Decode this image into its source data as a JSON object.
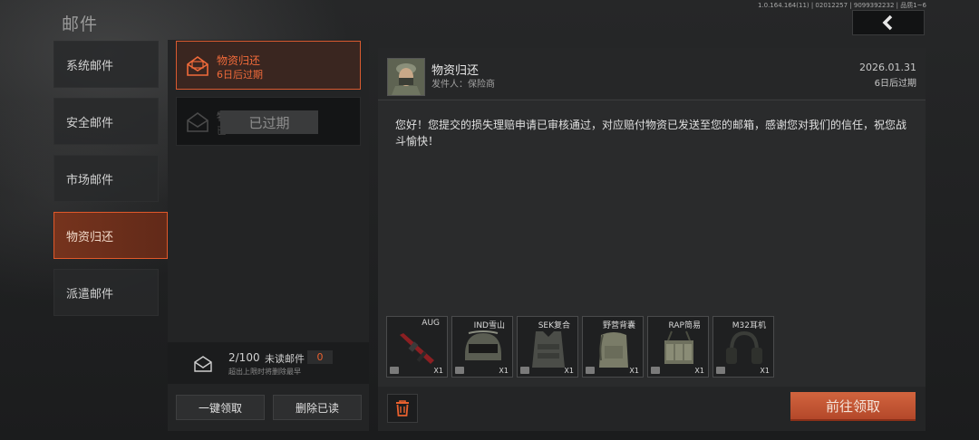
{
  "header": {
    "title": "邮件",
    "version": "1.0.164.164(11) | 02012257 | 9099392232 | 品质1~6",
    "back_icon": "chevron-left-icon"
  },
  "categories": [
    {
      "label": "系统邮件",
      "active": false
    },
    {
      "label": "安全邮件",
      "active": false
    },
    {
      "label": "市场邮件",
      "active": false
    },
    {
      "label": "物资归还",
      "active": true
    },
    {
      "label": "派遣邮件",
      "active": false
    }
  ],
  "mails": [
    {
      "name": "物资归还",
      "expiry": "6日后过期",
      "icon": "envelope-open-icon"
    },
    {
      "name": "物",
      "expiry": "已",
      "expired_label": "已过期",
      "icon": "envelope-open-icon"
    }
  ],
  "counter": {
    "count": "2/100",
    "unread_label": "未读邮件",
    "unread_count": "0",
    "note": "超出上限时将删除最早"
  },
  "buttons": {
    "claim_all": "一键领取",
    "delete_read": "删除已读",
    "go_claim": "前往领取"
  },
  "detail": {
    "title": "物资归还",
    "sender": "发件人：保险商",
    "date": "2026.01.31",
    "expiry": "6日后过期",
    "body": "您好！您提交的损失理赔申请已审核通过，对应赔付物资已发送至您的邮箱，感谢您对我们的信任，祝您战斗愉快！"
  },
  "attachments": [
    {
      "name": "AUG",
      "qty": "X1",
      "icon": "rifle-icon"
    },
    {
      "name": "IND雪山",
      "qty": "X1",
      "icon": "helmet-icon"
    },
    {
      "name": "SEK复合",
      "qty": "X1",
      "icon": "vest-icon"
    },
    {
      "name": "野营背囊",
      "qty": "X1",
      "icon": "backpack-icon"
    },
    {
      "name": "RAP简易",
      "qty": "X1",
      "icon": "chest-rig-icon"
    },
    {
      "name": "M32耳机",
      "qty": "X1",
      "icon": "headset-icon"
    }
  ],
  "colors": {
    "accent": "#e0582a",
    "panel": "#2a2b2c",
    "background": "#1d1e1f"
  }
}
